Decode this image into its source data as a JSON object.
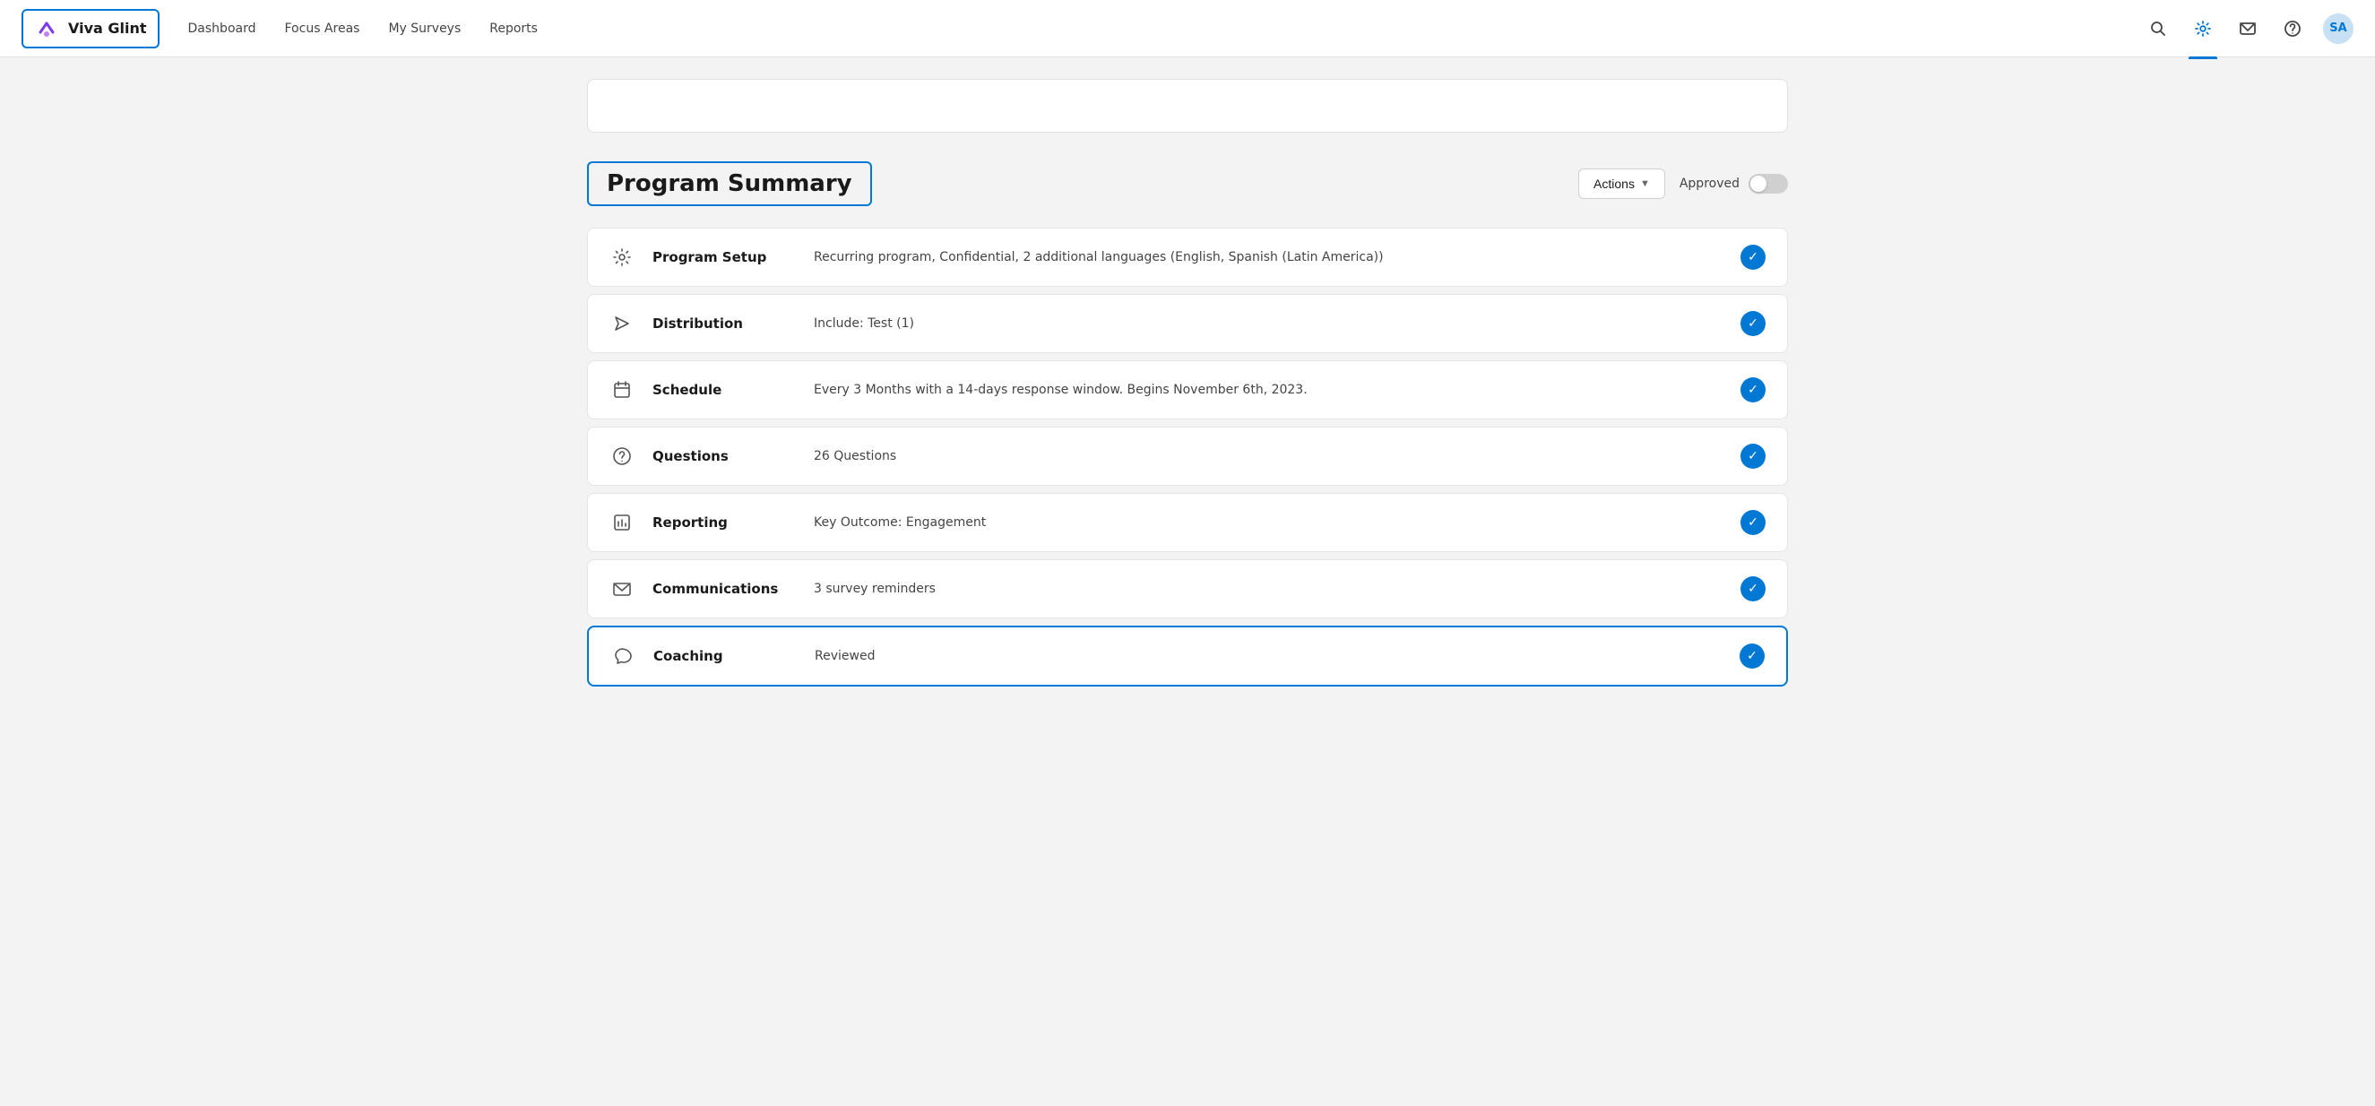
{
  "app": {
    "logo_text": "Viva Glint"
  },
  "navbar": {
    "links": [
      {
        "id": "dashboard",
        "label": "Dashboard"
      },
      {
        "id": "focus-areas",
        "label": "Focus Areas"
      },
      {
        "id": "my-surveys",
        "label": "My Surveys"
      },
      {
        "id": "reports",
        "label": "Reports"
      }
    ],
    "avatar_initials": "SA"
  },
  "program_summary": {
    "title": "Program Summary",
    "actions_label": "Actions",
    "approved_label": "Approved",
    "rows": [
      {
        "id": "program-setup",
        "label": "Program Setup",
        "description": "Recurring program, Confidential, 2 additional languages (English, Spanish (Latin America))",
        "icon": "gear",
        "highlighted": false
      },
      {
        "id": "distribution",
        "label": "Distribution",
        "description": "Include: Test (1)",
        "icon": "arrow",
        "highlighted": false
      },
      {
        "id": "schedule",
        "label": "Schedule",
        "description": "Every 3 Months with a 14-days response window. Begins November 6th, 2023.",
        "icon": "calendar",
        "highlighted": false
      },
      {
        "id": "questions",
        "label": "Questions",
        "description": "26 Questions",
        "icon": "question-circle",
        "highlighted": false
      },
      {
        "id": "reporting",
        "label": "Reporting",
        "description": "Key Outcome: Engagement",
        "icon": "bar-chart",
        "highlighted": false
      },
      {
        "id": "communications",
        "label": "Communications",
        "description": "3 survey reminders",
        "icon": "envelope",
        "highlighted": false
      },
      {
        "id": "coaching",
        "label": "Coaching",
        "description": "Reviewed",
        "icon": "chat",
        "highlighted": true
      }
    ]
  }
}
